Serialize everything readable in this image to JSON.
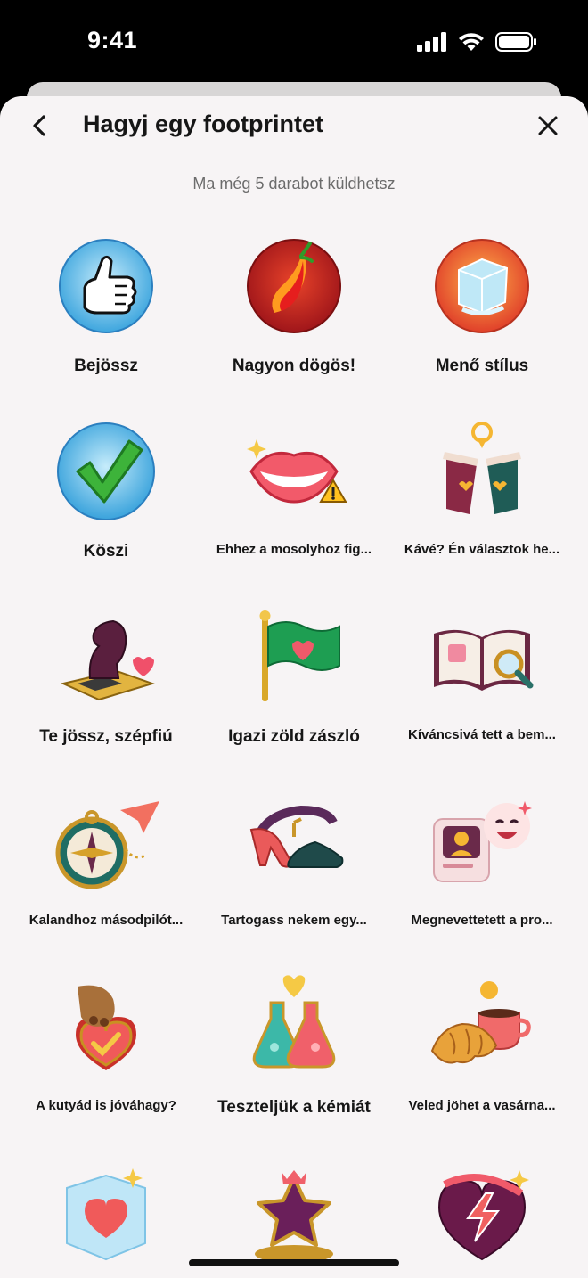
{
  "status": {
    "time": "9:41"
  },
  "header": {
    "title": "Hagyj egy footprintet",
    "back_icon": "chevron-left-icon",
    "close_icon": "close-icon"
  },
  "subtitle": "Ma még 5 darabot küldhetsz",
  "stickers": [
    {
      "label": "Bejössz",
      "icon": "thumbs-up-icon",
      "size": "big"
    },
    {
      "label": "Nagyon dögös!",
      "icon": "chili-pepper-icon",
      "size": "big"
    },
    {
      "label": "Menő stílus",
      "icon": "ice-cube-icon",
      "size": "big"
    },
    {
      "label": "Köszi",
      "icon": "checkmark-icon",
      "size": "big"
    },
    {
      "label": "Ehhez a mosolyhoz fig...",
      "icon": "lips-warning-icon",
      "size": "small"
    },
    {
      "label": "Kávé? Én választok he...",
      "icon": "coffee-cups-icon",
      "size": "small"
    },
    {
      "label": "Te jössz, szépfiú",
      "icon": "chess-knight-icon",
      "size": "big"
    },
    {
      "label": "Igazi zöld zászló",
      "icon": "green-flag-icon",
      "size": "big"
    },
    {
      "label": "Kíváncsivá tett a bem...",
      "icon": "book-magnifier-icon",
      "size": "small"
    },
    {
      "label": "Kalandhoz másodpilót...",
      "icon": "compass-plane-icon",
      "size": "small"
    },
    {
      "label": "Tartogass nekem egy...",
      "icon": "dance-shoes-icon",
      "size": "small"
    },
    {
      "label": "Megnevettetett a pro...",
      "icon": "laughing-profile-icon",
      "size": "small"
    },
    {
      "label": "A kutyád is jóváhagy?",
      "icon": "paw-heart-icon",
      "size": "small"
    },
    {
      "label": "Teszteljük a kémiát",
      "icon": "chemistry-flasks-icon",
      "size": "big"
    },
    {
      "label": "Veled jöhet a vasárna...",
      "icon": "croissant-coffee-icon",
      "size": "small"
    },
    {
      "label": "",
      "icon": "ice-heart-icon",
      "size": "small"
    },
    {
      "label": "",
      "icon": "star-crown-icon",
      "size": "small"
    },
    {
      "label": "",
      "icon": "lightning-heart-icon",
      "size": "small"
    }
  ]
}
